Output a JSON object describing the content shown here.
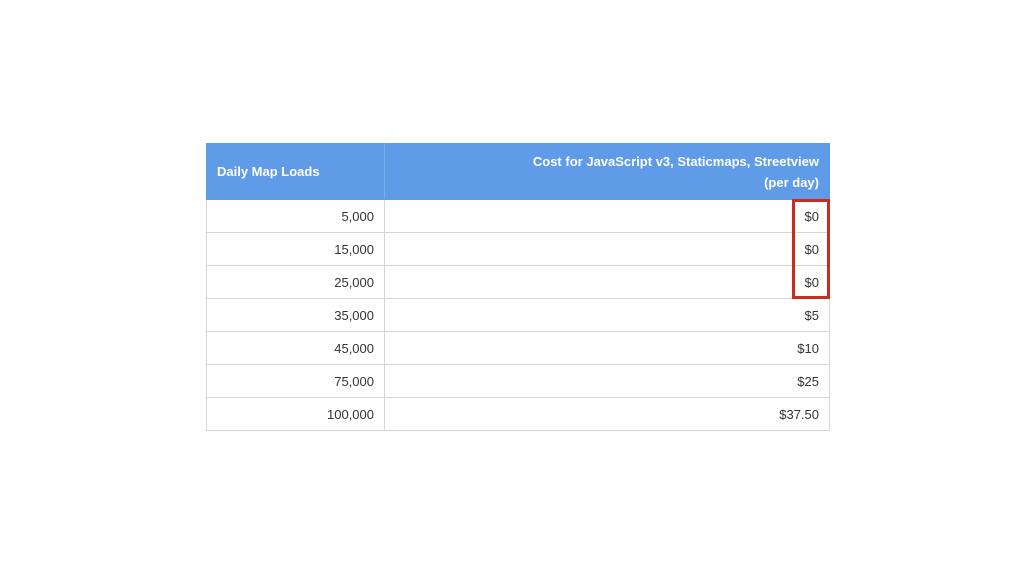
{
  "table": {
    "headers": {
      "loads": "Daily Map Loads",
      "cost_line1": "Cost for JavaScript v3, Staticmaps, Streetview",
      "cost_line2": "(per day)"
    },
    "rows": [
      {
        "loads": "5,000",
        "cost": "$0"
      },
      {
        "loads": "15,000",
        "cost": "$0"
      },
      {
        "loads": "25,000",
        "cost": "$0"
      },
      {
        "loads": "35,000",
        "cost": "$5"
      },
      {
        "loads": "45,000",
        "cost": "$10"
      },
      {
        "loads": "75,000",
        "cost": "$25"
      },
      {
        "loads": "100,000",
        "cost": "$37.50"
      }
    ]
  },
  "highlight": {
    "color": "#cc2a1d",
    "covers_rows": [
      0,
      1,
      2
    ]
  },
  "colors": {
    "header_background": "#5f9be6",
    "header_text": "#ffffff"
  }
}
